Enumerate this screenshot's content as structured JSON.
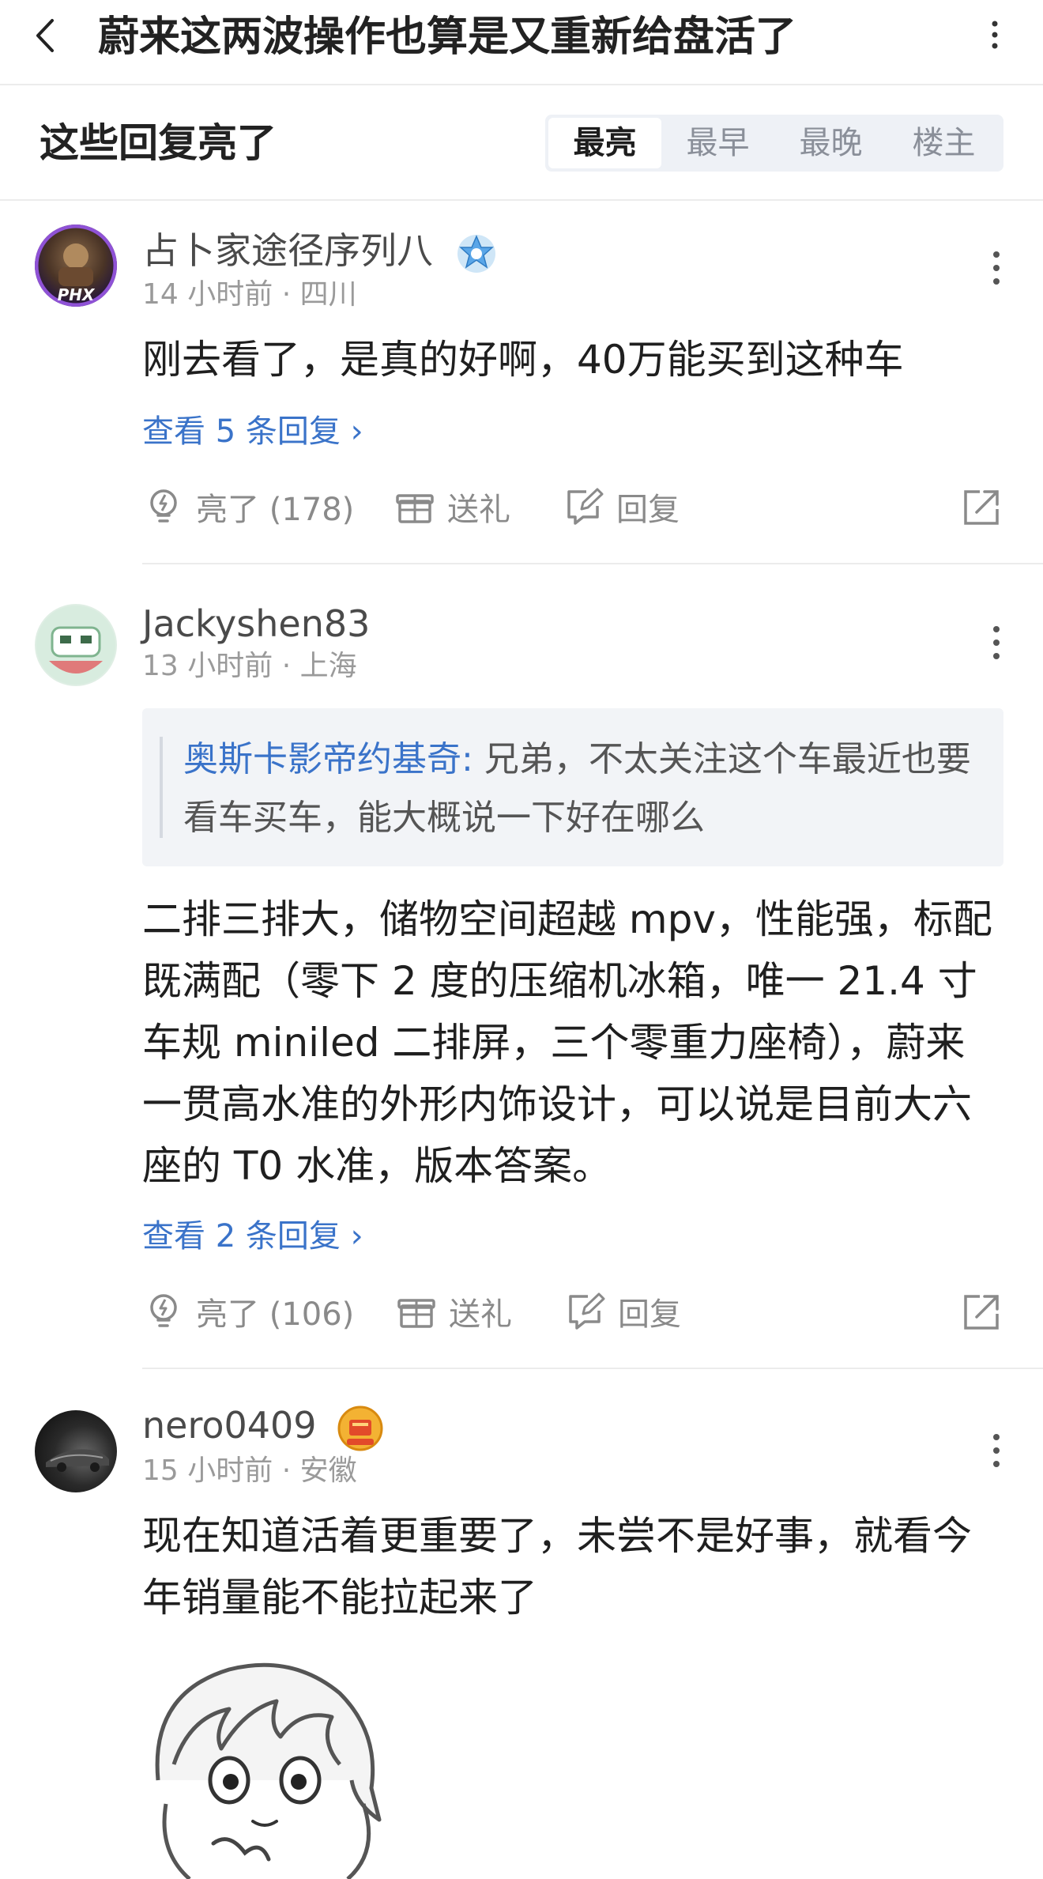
{
  "header": {
    "title": "蔚来这两波操作也算是又重新给盘活了"
  },
  "section": {
    "title": "这些回复亮了",
    "tabs": [
      "最亮",
      "最早",
      "最晚",
      "楼主"
    ],
    "active_tab": "最亮"
  },
  "comments": [
    {
      "username": "占卜家途径序列八",
      "meta": "14 小时前 · 四川",
      "avatar_text": "PHX",
      "body": "刚去看了，是真的好啊，40万能买到这种车",
      "view_replies": "查看 5 条回复",
      "like_label": "亮了 (178)",
      "gift_label": "送礼",
      "reply_label": "回复"
    },
    {
      "username": "Jackyshen83",
      "meta": "13 小时前 · 上海",
      "quote_author": "奥斯卡影帝约基奇:",
      "quote_text": " 兄弟，不太关注这个车最近也要看车买车，能大概说一下好在哪么",
      "body": "二排三排大，储物空间超越 mpv，性能强，标配既满配（零下 2 度的压缩机冰箱，唯一 21.4 寸车规 miniled 二排屏，三个零重力座椅），蔚来一贯高水准的外形内饰设计，可以说是目前大六座的 T0 水准，版本答案。",
      "view_replies": "查看 2 条回复",
      "like_label": "亮了 (106)",
      "gift_label": "送礼",
      "reply_label": "回复"
    },
    {
      "username": "nero0409",
      "meta": "15 小时前 · 安徽",
      "body": "现在知道活着更重要了，未尝不是好事，就看今年销量能不能拉起来了"
    }
  ],
  "colors": {
    "link": "#3a73c9",
    "meta": "#9a9a9a",
    "divider": "#ececec"
  }
}
